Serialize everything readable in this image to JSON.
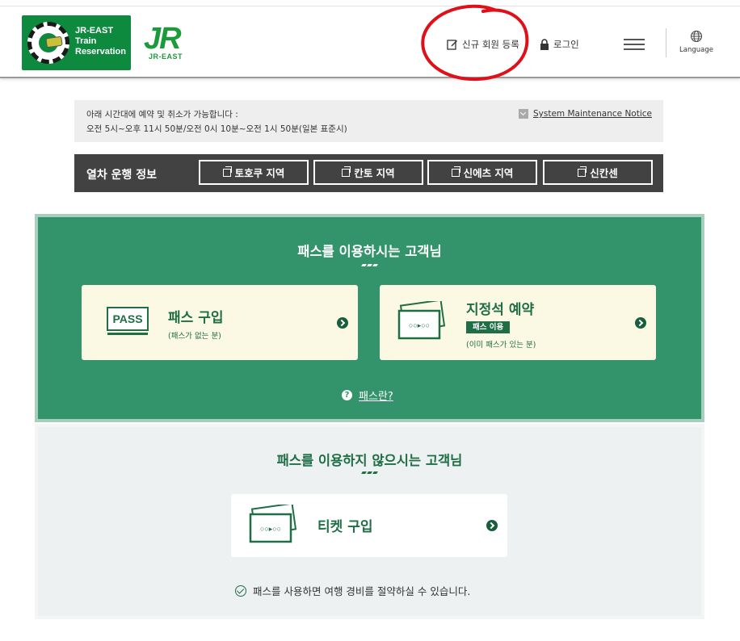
{
  "header": {
    "logo_lines": [
      "JR-EAST",
      "Train",
      "Reservation"
    ],
    "jr_brand": "JR",
    "jr_east": "JR-EAST",
    "register_label": "신규 회원 등록",
    "login_label": "로그인",
    "language_label": "Language",
    "icons": [
      "edit-icon",
      "lock-icon",
      "hamburger-menu-icon",
      "globe-icon"
    ]
  },
  "notice": {
    "line1": "아래 시간대에 예약 및 취소가 가능합니다 :",
    "line2": "오전 5시~오후 11시 50분/오전 0시 10분~오전 1시 50분(일본 표준시)",
    "maintenance_link": "System Maintenance Notice"
  },
  "train_info": {
    "title": "열차 운행 정보",
    "regions": [
      "토호쿠 지역",
      "칸토 지역",
      "신에츠 지역",
      "신칸센"
    ]
  },
  "pass_section": {
    "title": "패스를 이용하시는 고객님",
    "buy_pass": {
      "icon_text": "PASS",
      "title": "패스 구입",
      "subtitle": "(패스가 없는 분)"
    },
    "reserve_seat": {
      "title": "지정석 예약",
      "badge": "패스 이용",
      "subtitle": "(이미 패스가 있는 분)"
    },
    "help_link": "패스란?"
  },
  "no_pass_section": {
    "title": "패스를 이용하지 않으시는 고객님",
    "buy_ticket": {
      "title": "티켓 구입"
    },
    "tip": "패스를 사용하면 여행 경비를 절약하실 수 있습니다."
  },
  "colors": {
    "brand_green": "#0e8a3f",
    "section_green": "#33936b",
    "dark_green": "#1f6e46",
    "card_cream": "#fbf8e4",
    "annotation_red": "#e0101a"
  }
}
